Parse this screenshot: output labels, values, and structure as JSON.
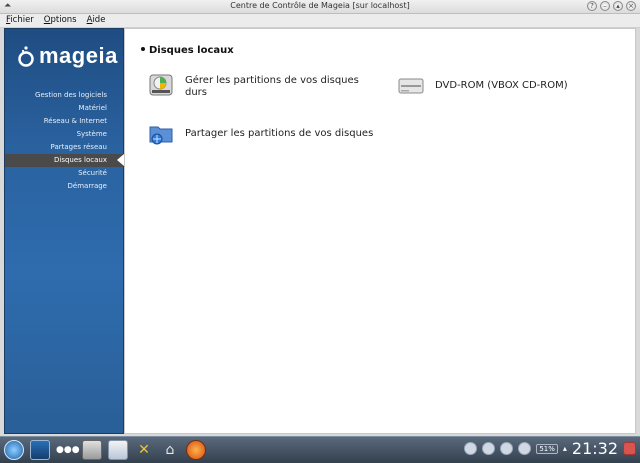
{
  "window": {
    "title": "Centre de Contrôle de Mageia  [sur localhost]"
  },
  "menubar": {
    "items": [
      {
        "label": "Fichier",
        "accel": "F",
        "rest": "ichier"
      },
      {
        "label": "Options",
        "accel": "O",
        "rest": "ptions"
      },
      {
        "label": "Aide",
        "accel": "A",
        "rest": "ide"
      }
    ]
  },
  "sidebar": {
    "logo_text": "mageia",
    "items": [
      {
        "label": "Gestion des logiciels"
      },
      {
        "label": "Matériel"
      },
      {
        "label": "Réseau & Internet"
      },
      {
        "label": "Système"
      },
      {
        "label": "Partages réseau"
      },
      {
        "label": "Disques locaux"
      },
      {
        "label": "Sécurité"
      },
      {
        "label": "Démarrage"
      }
    ]
  },
  "main": {
    "section_title": "Disques locaux",
    "tools": [
      {
        "label": "Gérer les partitions de vos disques durs"
      },
      {
        "label": "DVD-ROM (VBOX CD-ROM)"
      },
      {
        "label": "Partager les partitions de vos disques"
      }
    ]
  },
  "taskbar": {
    "clock": "21:32",
    "battery": "51%"
  }
}
